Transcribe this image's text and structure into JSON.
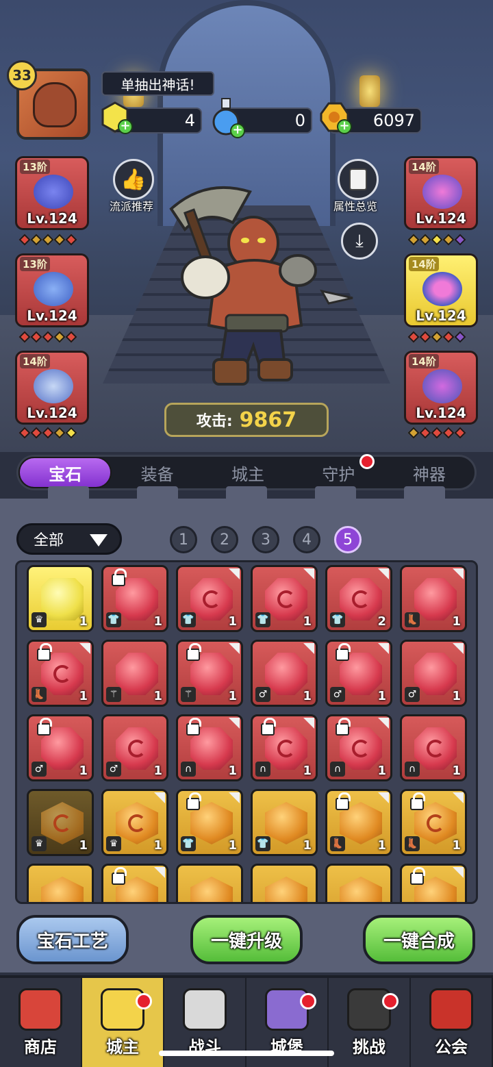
{
  "player": {
    "level": "33",
    "title": "单抽出神话!"
  },
  "currencies": [
    {
      "icon": "gem-currency-icon",
      "value": "4"
    },
    {
      "icon": "potion-currency-icon",
      "value": "0"
    },
    {
      "icon": "gold-coin-icon",
      "value": "6097"
    }
  ],
  "side_buttons": {
    "recommend": "流派推荐",
    "attributes": "属性总览"
  },
  "left_equipment": [
    {
      "tier": "13阶",
      "level": "Lv.124",
      "icon": "wizard-hat-icon"
    },
    {
      "tier": "13阶",
      "level": "Lv.124",
      "icon": "robe-icon"
    },
    {
      "tier": "14阶",
      "level": "Lv.124",
      "icon": "boot-icon"
    }
  ],
  "right_equipment": [
    {
      "tier": "14阶",
      "level": "Lv.124",
      "icon": "staff-icon"
    },
    {
      "tier": "14阶",
      "level": "Lv.124",
      "icon": "ring-icon"
    },
    {
      "tier": "14阶",
      "level": "Lv.124",
      "icon": "necklace-icon"
    }
  ],
  "attack": {
    "label": "攻击:",
    "value": "9867"
  },
  "tabs": [
    "宝石",
    "装备",
    "城主",
    "守护",
    "神器"
  ],
  "filter": {
    "label": "全部"
  },
  "pages": [
    "1",
    "2",
    "3",
    "4",
    "5"
  ],
  "gems": [
    {
      "color": "yellow",
      "lock": false,
      "corner": false,
      "slot": "♛",
      "count": "1"
    },
    {
      "color": "red",
      "lock": true,
      "corner": false,
      "slot": "👕",
      "count": "1"
    },
    {
      "color": "red",
      "lock": false,
      "corner": true,
      "swirl": true,
      "slot": "👕",
      "count": "1"
    },
    {
      "color": "red",
      "lock": false,
      "corner": true,
      "swirl": true,
      "slot": "👕",
      "count": "1"
    },
    {
      "color": "red",
      "lock": false,
      "corner": true,
      "swirl": true,
      "slot": "👕",
      "count": "2"
    },
    {
      "color": "red",
      "lock": false,
      "corner": true,
      "slot": "👢",
      "count": "1"
    },
    {
      "color": "red",
      "lock": true,
      "corner": true,
      "swirl": true,
      "slot": "👢",
      "count": "1"
    },
    {
      "color": "red",
      "lock": false,
      "corner": false,
      "slot": "⚚",
      "count": "1"
    },
    {
      "color": "red",
      "lock": true,
      "corner": true,
      "slot": "⚚",
      "count": "1"
    },
    {
      "color": "red",
      "lock": false,
      "corner": true,
      "slot": "♂",
      "count": "1"
    },
    {
      "color": "red",
      "lock": true,
      "corner": true,
      "slot": "♂",
      "count": "1"
    },
    {
      "color": "red",
      "lock": false,
      "corner": true,
      "slot": "♂",
      "count": "1"
    },
    {
      "color": "red",
      "lock": true,
      "corner": false,
      "slot": "♂",
      "count": "1"
    },
    {
      "color": "red",
      "lock": false,
      "corner": false,
      "swirl": true,
      "slot": "♂",
      "count": "1"
    },
    {
      "color": "red",
      "lock": true,
      "corner": true,
      "slot": "∩",
      "count": "1"
    },
    {
      "color": "red",
      "lock": true,
      "corner": true,
      "swirl": true,
      "slot": "∩",
      "count": "1"
    },
    {
      "color": "red",
      "lock": true,
      "corner": true,
      "swirl": true,
      "slot": "∩",
      "count": "1"
    },
    {
      "color": "red",
      "lock": false,
      "corner": false,
      "swirl": true,
      "slot": "∩",
      "count": "1"
    },
    {
      "color": "dim",
      "lock": false,
      "corner": false,
      "swirl": true,
      "slot": "♛",
      "count": "1"
    },
    {
      "color": "orange",
      "lock": false,
      "corner": true,
      "swirl": true,
      "slot": "♛",
      "count": "1"
    },
    {
      "color": "orange",
      "lock": true,
      "corner": true,
      "slot": "👕",
      "count": "1"
    },
    {
      "color": "orange",
      "lock": false,
      "corner": false,
      "slot": "👕",
      "count": "1"
    },
    {
      "color": "orange",
      "lock": true,
      "corner": true,
      "slot": "👢",
      "count": "1"
    },
    {
      "color": "orange",
      "lock": true,
      "corner": true,
      "swirl": true,
      "slot": "👢",
      "count": "1"
    },
    {
      "color": "orange",
      "lock": false,
      "corner": false,
      "slot": "",
      "count": ""
    },
    {
      "color": "orange",
      "lock": true,
      "corner": true,
      "slot": "",
      "count": ""
    },
    {
      "color": "orange",
      "lock": false,
      "corner": false,
      "slot": "",
      "count": ""
    },
    {
      "color": "orange",
      "lock": false,
      "corner": false,
      "slot": "",
      "count": ""
    },
    {
      "color": "orange",
      "lock": false,
      "corner": false,
      "slot": "",
      "count": ""
    },
    {
      "color": "orange",
      "lock": true,
      "corner": true,
      "slot": "",
      "count": ""
    }
  ],
  "actions": {
    "craft": "宝石工艺",
    "upgrade": "一键升级",
    "merge": "一键合成"
  },
  "nav": [
    {
      "label": "商店",
      "icon": "shop-icon",
      "dot": false,
      "active": false
    },
    {
      "label": "城主",
      "icon": "crown-icon",
      "dot": true,
      "active": true
    },
    {
      "label": "战斗",
      "icon": "crossed-swords-icon",
      "dot": false,
      "active": false
    },
    {
      "label": "城堡",
      "icon": "castle-icon",
      "dot": true,
      "active": false
    },
    {
      "label": "挑战",
      "icon": "demon-icon",
      "dot": true,
      "active": false
    },
    {
      "label": "公会",
      "icon": "guild-banner-icon",
      "dot": false,
      "active": false
    }
  ],
  "colors": {
    "accent": "#8e45d6",
    "red_gem": "#d73a4e",
    "gold": "#f3d34a",
    "green_button": "#55bd3a"
  }
}
